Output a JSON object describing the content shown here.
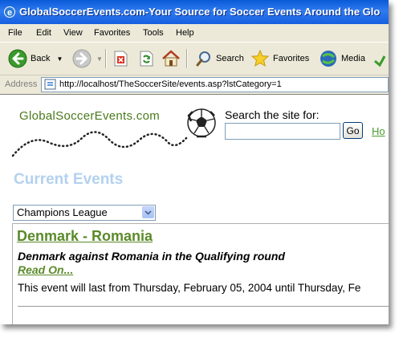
{
  "window": {
    "title": "GlobalSoccerEvents.com-Your Source for Soccer Events Around the Glo"
  },
  "menu": {
    "items": [
      "File",
      "Edit",
      "View",
      "Favorites",
      "Tools",
      "Help"
    ]
  },
  "toolbar": {
    "back_label": "Back",
    "search_label": "Search",
    "favorites_label": "Favorites",
    "media_label": "Media"
  },
  "address_bar": {
    "label": "Address",
    "url": "http://localhost/TheSoccerSite/events.asp?lstCategory=1"
  },
  "page": {
    "logo_text": "GlobalSoccerEvents.com",
    "search_label": "Search the site for:",
    "search_value": "",
    "go_label": "Go",
    "home_link": "Ho",
    "section_title": "Current Events",
    "category_selected": "Champions League",
    "event": {
      "title": "Denmark - Romania",
      "summary": "Denmark against Romania in the Qualifying round",
      "read_on": "Read On...",
      "duration": "This event will last from Thursday, February 05, 2004 until Thursday, Fe"
    }
  },
  "colors": {
    "title_bar": "#0a5ad8",
    "chrome": "#ece9d8",
    "logo": "#4a7a1c",
    "section_title": "#b3d1ee",
    "event_link": "#5b8a2a"
  },
  "icons": [
    "ie-icon",
    "back-icon",
    "forward-icon",
    "stop-icon",
    "refresh-icon",
    "home-icon",
    "search-icon",
    "favorites-star-icon",
    "media-icon",
    "history-icon",
    "page-icon",
    "soccer-ball-icon",
    "dropdown-arrow-icon"
  ]
}
